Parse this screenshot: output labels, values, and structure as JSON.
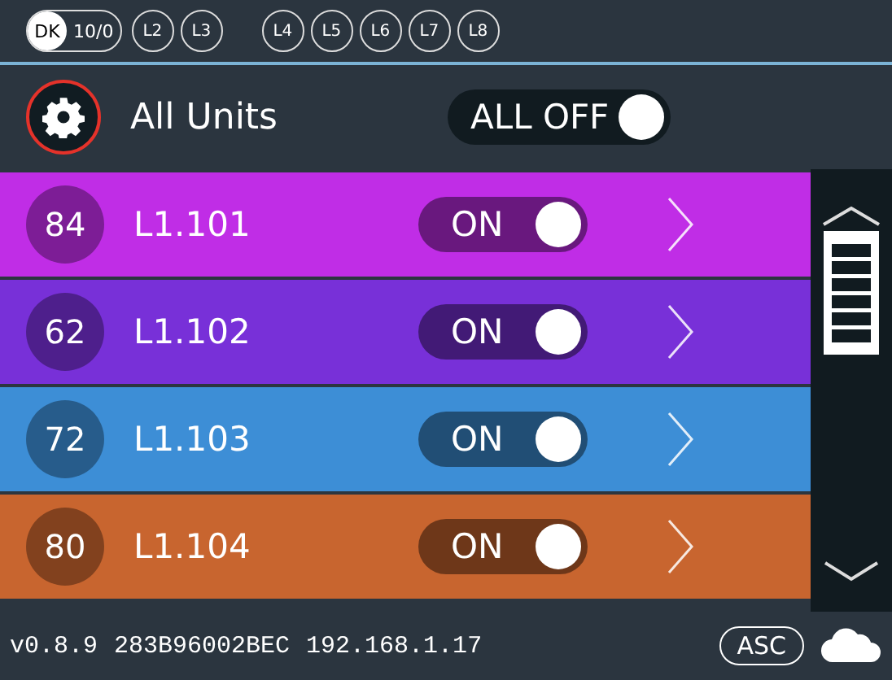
{
  "top_bar": {
    "mode_options": [
      {
        "label": "DK",
        "selected": true
      },
      {
        "label": "10/0",
        "selected": false
      }
    ],
    "level_groups": [
      [
        "L2",
        "L3"
      ],
      [
        "L4",
        "L5",
        "L6",
        "L7",
        "L8"
      ]
    ]
  },
  "header": {
    "title": "All Units",
    "all_off_button": "ALL OFF"
  },
  "units": [
    {
      "number": "84",
      "name": "L1.101",
      "color": "#c02de6",
      "toggle": "ON",
      "on": true
    },
    {
      "number": "62",
      "name": "L1.102",
      "color": "#7830d8",
      "toggle": "ON",
      "on": true
    },
    {
      "number": "72",
      "name": "L1.103",
      "color": "#3d8ed6",
      "toggle": "ON",
      "on": true
    },
    {
      "number": "80",
      "name": "L1.104",
      "color": "#c8652f",
      "toggle": "ON",
      "on": true
    }
  ],
  "footer": {
    "version": "v0.8.9",
    "serial": "283B96002BEC",
    "ip": "192.168.1.17",
    "sort_button": "ASC"
  }
}
